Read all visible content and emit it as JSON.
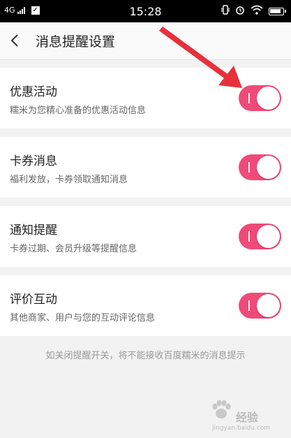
{
  "status_bar": {
    "network": "4G",
    "time": "15:28",
    "check_glyph": "✓"
  },
  "header": {
    "back_icon": "chevron-left-icon",
    "title": "消息提醒设置"
  },
  "settings": [
    {
      "title": "优惠活动",
      "description": "糯米为您精心准备的优惠活动信息",
      "enabled": true
    },
    {
      "title": "卡券消息",
      "description": "福利发放，卡券领取通知消息",
      "enabled": true
    },
    {
      "title": "通知提醒",
      "description": "卡券过期、会员升级等提醒信息",
      "enabled": true
    },
    {
      "title": "评价互动",
      "description": "其他商家、用户与您的互动评论信息",
      "enabled": true
    }
  ],
  "footer_note": "如关闭提醒开关，将不能接收百度糯米的消息提示",
  "watermark": {
    "text": "经验",
    "url": "jingyan.baidu.com"
  },
  "colors": {
    "toggle_on": "#f04a78",
    "arrow": "#e8303a",
    "background": "#f2f2f2"
  }
}
